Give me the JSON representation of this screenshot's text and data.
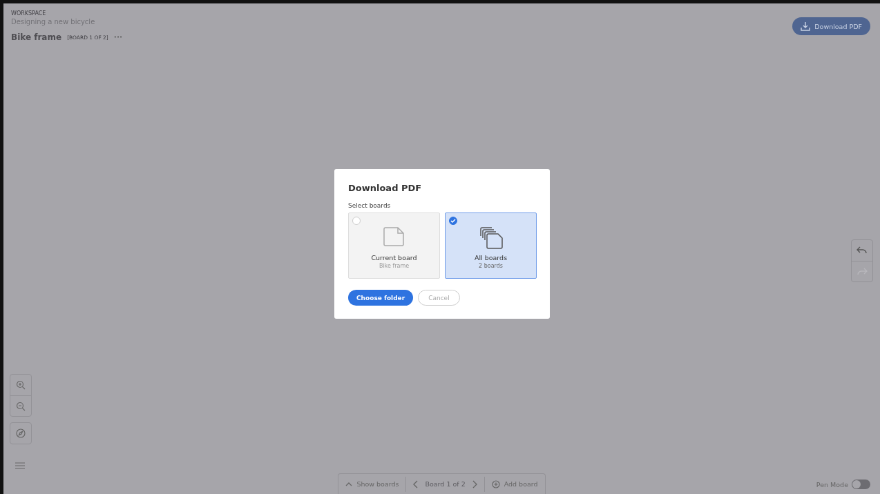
{
  "header": {
    "eyebrow": "WORKSPACE",
    "workspace": "Designing a new bicycle",
    "board_title": "Bike frame",
    "board_position": "[BOARD 1 OF 2]",
    "more": "•••"
  },
  "download_button": "Download PDF",
  "dialog": {
    "title": "Download PDF",
    "section_label": "Select boards",
    "options": [
      {
        "kind": "single",
        "title": "Current board",
        "subtitle": "Bike frame",
        "selected": false
      },
      {
        "kind": "multiple",
        "title": "All boards",
        "subtitle": "2 boards",
        "selected": true
      }
    ],
    "primary_button": "Choose folder",
    "cancel_button": "Cancel"
  },
  "history": [
    {
      "kind": "undo",
      "disabled": false
    },
    {
      "kind": "redo",
      "disabled": true
    }
  ],
  "bottom_bar": {
    "show_boards": "Show boards",
    "position": "Board 1 of 2",
    "add_board": "Add board"
  },
  "pen_mode": {
    "label": "Pen Mode",
    "on": false
  }
}
